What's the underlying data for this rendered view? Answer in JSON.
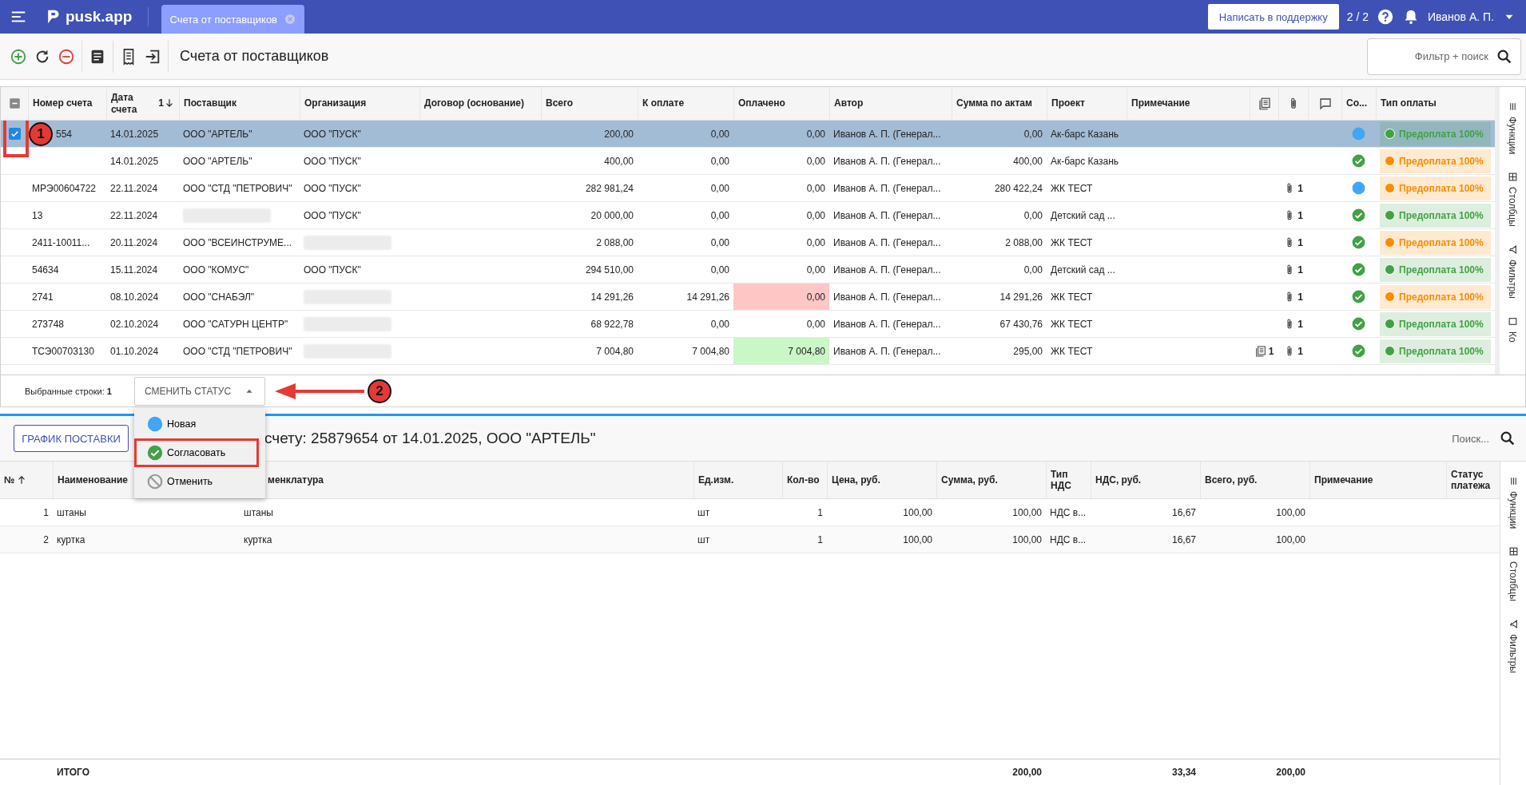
{
  "app_bar": {
    "logo": "pusk.app",
    "tabs": [
      {
        "label": "Счета от поставщиков",
        "selected": true
      }
    ],
    "support_button": "Написать в поддержку",
    "counter": "2 / 2",
    "user": "Иванов А. П."
  },
  "toolbar": {
    "title": "Счета от поставщиков",
    "search": {
      "placeholder": "Фильтр + поиск"
    }
  },
  "grid": {
    "select_all_indeterminate": true,
    "columns": [
      {
        "label": "Номер счета"
      },
      {
        "label": "Дата счета",
        "sort_descending": true,
        "sort_order": "1"
      },
      {
        "label": "Поставщик"
      },
      {
        "label": "Организация"
      },
      {
        "label": "Договор (основание)"
      },
      {
        "label": "Всего"
      },
      {
        "label": "К оплате"
      },
      {
        "label": "Оплачено"
      },
      {
        "label": "Автор"
      },
      {
        "label": "Сумма по актам"
      },
      {
        "label": "Проект"
      },
      {
        "label": "Примечание"
      },
      {
        "kind": "icon"
      },
      {
        "kind": "icon"
      },
      {
        "kind": "icon"
      },
      {
        "label": "Со..."
      },
      {
        "label": "Тип оплаты"
      }
    ],
    "rows": [
      {
        "checked": true,
        "selected": true,
        "annotation": "1",
        "number": "554",
        "date": "14.01.2025",
        "supplier": "ООО \"АРТЕЛЬ\"",
        "supplier_redacted": false,
        "organization": "ООО \"ПУСК\"",
        "organization_redacted": false,
        "total": "200,00",
        "to_pay": "0,00",
        "paid": {
          "text": "0,00"
        },
        "author": "Иванов А. П. (Генерал...",
        "acts_sum": "0,00",
        "project": "Ак-барс Казань",
        "status": {
          "kind": "new"
        },
        "payment": {
          "label": "Предоплата 100%",
          "color": "#43a047"
        }
      },
      {
        "checked": false,
        "selected": false,
        "date": "14.01.2025",
        "supplier": "ООО \"АРТЕЛЬ\"",
        "supplier_redacted": false,
        "organization": "ООО \"ПУСК\"",
        "organization_redacted": false,
        "total": "400,00",
        "to_pay": "0,00",
        "paid": {
          "text": "0,00"
        },
        "author": "Иванов А. П. (Генерал...",
        "acts_sum": "400,00",
        "project": "Ак-барс Казань",
        "status": {
          "kind": "approved"
        },
        "payment": {
          "label": "Предоплата 100%",
          "color": "#fb8c00"
        }
      },
      {
        "checked": false,
        "selected": false,
        "number": "МРЭ00604722",
        "date": "22.11.2024",
        "supplier": "ООО \"СТД \"ПЕТРОВИЧ\"",
        "supplier_redacted": false,
        "organization": "ООО \"ПУСК\"",
        "organization_redacted": false,
        "total": "282 981,24",
        "to_pay": "0,00",
        "paid": {
          "text": "0,00"
        },
        "author": "Иванов А. П. (Генерал...",
        "acts_sum": "280 422,24",
        "project": "ЖК ТЕСТ",
        "attachments_count": "1",
        "status": {
          "kind": "new"
        },
        "payment": {
          "label": "Предоплата 100%",
          "color": "#fb8c00"
        }
      },
      {
        "checked": false,
        "selected": false,
        "number": "13",
        "date": "22.11.2024",
        "supplier_redacted": true,
        "organization": "ООО \"ПУСК\"",
        "organization_redacted": false,
        "total": "20 000,00",
        "to_pay": "0,00",
        "paid": {
          "text": "0,00"
        },
        "author": "Иванов А. П. (Генерал...",
        "acts_sum": "0,00",
        "project": "Детский сад ...",
        "attachments_count": "1",
        "status": {
          "kind": "approved"
        },
        "payment": {
          "label": "Предоплата 100%",
          "color": "#43a047"
        }
      },
      {
        "checked": false,
        "selected": false,
        "number": "2411-10011...",
        "date": "20.11.2024",
        "supplier": "ООО \"ВСЕИНСТРУМЕ...",
        "supplier_redacted": false,
        "organization_redacted": true,
        "total": "2 088,00",
        "to_pay": "0,00",
        "paid": {
          "text": "0,00"
        },
        "author": "Иванов А. П. (Генерал...",
        "acts_sum": "2 088,00",
        "project": "ЖК ТЕСТ",
        "attachments_count": "1",
        "status": {
          "kind": "approved"
        },
        "payment": {
          "label": "Предоплата 100%",
          "color": "#fb8c00"
        }
      },
      {
        "checked": false,
        "selected": false,
        "number": "54634",
        "date": "15.11.2024",
        "supplier": "ООО \"КОМУС\"",
        "supplier_redacted": false,
        "organization": "ООО \"ПУСК\"",
        "organization_redacted": false,
        "total": "294 510,00",
        "to_pay": "0,00",
        "paid": {
          "text": "0,00"
        },
        "author": "Иванов А. П. (Генерал...",
        "acts_sum": "0,00",
        "project": "Детский сад ...",
        "attachments_count": "1",
        "status": {
          "kind": "approved"
        },
        "payment": {
          "label": "Предоплата 100%",
          "color": "#43a047"
        }
      },
      {
        "checked": false,
        "selected": false,
        "number": "2741",
        "date": "08.10.2024",
        "supplier": "ООО \"СНАБЭЛ\"",
        "supplier_redacted": false,
        "organization_redacted": true,
        "total": "14 291,26",
        "to_pay": "14 291,26",
        "paid": {
          "text": "0,00",
          "kind": "overdue"
        },
        "author": "Иванов А. П. (Генерал...",
        "acts_sum": "14 291,26",
        "project": "ЖК ТЕСТ",
        "attachments_count": "1",
        "status": {
          "kind": "approved"
        },
        "payment": {
          "label": "Предоплата 100%",
          "color": "#fb8c00"
        }
      },
      {
        "checked": false,
        "selected": false,
        "number": "273748",
        "date": "02.10.2024",
        "supplier": "ООО \"САТУРН ЦЕНТР\"",
        "supplier_redacted": false,
        "organization_redacted": true,
        "total": "68 922,78",
        "to_pay": "0,00",
        "paid": {
          "text": "0,00"
        },
        "author": "Иванов А. П. (Генерал...",
        "acts_sum": "67 430,76",
        "project": "ЖК ТЕСТ",
        "attachments_count": "1",
        "status": {
          "kind": "approved"
        },
        "payment": {
          "label": "Предоплата 100%",
          "color": "#43a047"
        }
      },
      {
        "checked": false,
        "selected": false,
        "number": "ТСЭ00703130",
        "date": "01.10.2024",
        "supplier": "ООО \"СТД \"ПЕТРОВИЧ\"",
        "supplier_redacted": false,
        "organization_redacted": true,
        "total": "7 004,80",
        "to_pay": "7 004,80",
        "paid": {
          "text": "7 004,80",
          "kind": "paid"
        },
        "author": "Иванов А. П. (Генерал...",
        "acts_sum": "295,00",
        "project": "ЖК ТЕСТ",
        "documents_count": "1",
        "attachments_count": "1",
        "status": {
          "kind": "approved"
        },
        "payment": {
          "label": "Предоплата 100%",
          "color": "#43a047"
        }
      }
    ],
    "side_tabs": [
      {
        "label": "Функции"
      },
      {
        "label": "Столбцы"
      },
      {
        "label": "Фильтры"
      },
      {
        "label": "Ко"
      }
    ],
    "footer": {
      "selected_label": "Выбранные строки: **1**",
      "status_button": {
        "label": "СМЕНИТЬ СТАТУС",
        "expanded": true
      },
      "annotation": "2",
      "status_menu": [
        {
          "label": "Новая",
          "kind": "new",
          "framed": false
        },
        {
          "label": "Согласовать",
          "kind": "approved",
          "framed": true
        },
        {
          "label": "Отменить",
          "kind": "cancelled",
          "framed": false
        }
      ]
    }
  },
  "details": {
    "schedule_button": "ГРАФИК ПОСТАВКИ",
    "title": "счету: 25879654 от 14.01.2025, ООО \"АРТЕЛЬ\"",
    "search": {
      "placeholder": "Поиск..."
    },
    "columns": [
      {
        "label": "№",
        "sort_descending": false
      },
      {
        "label": "Наименование"
      },
      {
        "label": "менклатура"
      },
      {
        "label": "Ед.изм."
      },
      {
        "label": "Кол-во"
      },
      {
        "label": "Цена, руб."
      },
      {
        "label": "Сумма, руб."
      },
      {
        "label": "Тип НДС"
      },
      {
        "label": "НДС, руб."
      },
      {
        "label": "Всего, руб."
      },
      {
        "label": "Примечание"
      },
      {
        "label": "Статус платежа"
      }
    ],
    "rows": [
      {
        "cells": [
          "1",
          "штаны",
          "штаны",
          "шт",
          "1",
          "100,00",
          "100,00",
          "НДС в...",
          "16,67",
          "100,00"
        ]
      },
      {
        "cells": [
          "2",
          "куртка",
          "куртка",
          "шт",
          "1",
          "100,00",
          "100,00",
          "НДС в...",
          "16,67",
          "100,00"
        ]
      }
    ],
    "totals": {
      "label": "ИТОГО",
      "sum": "200,00",
      "vat": "33,34",
      "total": "200,00"
    },
    "side_tabs": [
      {
        "label": "Функции"
      },
      {
        "label": "Столбцы"
      },
      {
        "label": "Фильтры"
      }
    ]
  }
}
